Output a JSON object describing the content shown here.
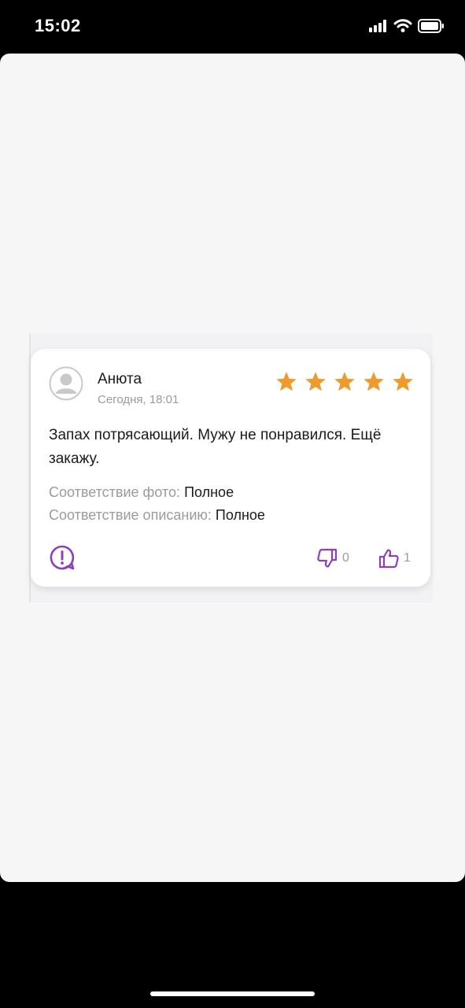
{
  "status_bar": {
    "time": "15:02",
    "icons": [
      "signal-icon",
      "wifi-icon",
      "battery-icon"
    ]
  },
  "review": {
    "author": "Анюта",
    "date": "Сегодня, 18:01",
    "rating": 5,
    "rating_max": 5,
    "text": "Запах потрясающий. Мужу не понравился. Ещё закажу.",
    "attributes": [
      {
        "label": "Соответствие фото:",
        "value": "Полное"
      },
      {
        "label": "Соответствие описанию:",
        "value": "Полное"
      }
    ],
    "dislikes": "0",
    "likes": "1"
  },
  "colors": {
    "star": "#ee9a2c",
    "accent": "#8d3fbf",
    "muted_text": "#9b9b9b",
    "text": "#1b1b1b",
    "sheet_background": "#f6f6f6"
  }
}
